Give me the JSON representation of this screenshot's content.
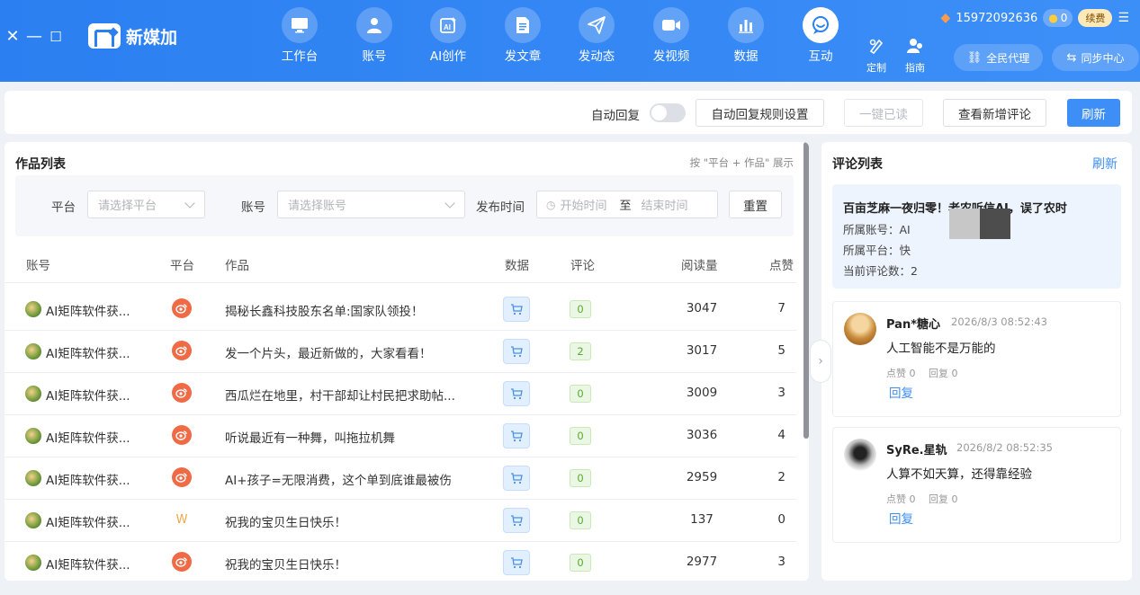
{
  "window": {
    "close": "✕",
    "minimize": "—",
    "maximize": "☐"
  },
  "brand": {
    "name": "新媒加"
  },
  "nav": [
    {
      "label": "工作台",
      "icon": "monitor-icon"
    },
    {
      "label": "账号",
      "icon": "user-icon"
    },
    {
      "label": "AI创作",
      "icon": "ai-icon"
    },
    {
      "label": "发文章",
      "icon": "document-icon"
    },
    {
      "label": "发动态",
      "icon": "paper-plane-icon"
    },
    {
      "label": "发视频",
      "icon": "video-camera-icon"
    },
    {
      "label": "数据",
      "icon": "bar-chart-icon"
    },
    {
      "label": "互动",
      "icon": "chat-bubble-icon",
      "active": true
    }
  ],
  "small_nav": [
    {
      "label": "定制",
      "icon": "customize-icon"
    },
    {
      "label": "指南",
      "icon": "guide-icon"
    }
  ],
  "pills": {
    "agent": "全民代理",
    "sync": "同步中心"
  },
  "account": {
    "phone": "15972092636",
    "coins": "0",
    "renew": "续费",
    "menu": "☰"
  },
  "toolbar": {
    "auto_reply_label": "自动回复",
    "auto_reply_rules": "自动回复规则设置",
    "mark_all_read": "一键已读",
    "view_new_comments": "查看新增评论",
    "refresh": "刷新"
  },
  "works": {
    "title": "作品列表",
    "hint": "按 \"平台 + 作品\" 展示",
    "filters": {
      "platform_label": "平台",
      "platform_placeholder": "请选择平台",
      "account_label": "账号",
      "account_placeholder": "请选择账号",
      "time_label": "发布时间",
      "start_placeholder": "开始时间",
      "to": "至",
      "end_placeholder": "结束时间",
      "reset": "重置"
    },
    "columns": [
      "账号",
      "平台",
      "作品",
      "数据",
      "评论",
      "阅读量",
      "点赞"
    ],
    "rows": [
      {
        "account": "AI矩阵软件获...",
        "platform": "weibo",
        "title": "揭秘长鑫科技股东名单:国家队领投！",
        "comments": "0",
        "reads": "3047",
        "likes": "7"
      },
      {
        "account": "AI矩阵软件获...",
        "platform": "weibo",
        "title": "发一个片头，最近新做的，大家看看！",
        "comments": "2",
        "reads": "3017",
        "likes": "5"
      },
      {
        "account": "AI矩阵软件获...",
        "platform": "weibo",
        "title": "西瓜烂在地里，村干部却让村民把求助帖...",
        "comments": "0",
        "reads": "3009",
        "likes": "3"
      },
      {
        "account": "AI矩阵软件获...",
        "platform": "weibo",
        "title": "听说最近有一种舞，叫拖拉机舞",
        "comments": "0",
        "reads": "3036",
        "likes": "4"
      },
      {
        "account": "AI矩阵软件获...",
        "platform": "weibo",
        "title": "AI+孩子=无限消费，这个单到底谁最被伤",
        "comments": "0",
        "reads": "2959",
        "likes": "2"
      },
      {
        "account": "AI矩阵软件获...",
        "platform": "w",
        "title": "祝我的宝贝生日快乐！",
        "comments": "0",
        "reads": "137",
        "likes": "0"
      },
      {
        "account": "AI矩阵软件获...",
        "platform": "weibo",
        "title": "祝我的宝贝生日快乐！",
        "comments": "0",
        "reads": "2977",
        "likes": "3"
      }
    ]
  },
  "comments": {
    "title": "评论列表",
    "refresh": "刷新",
    "post": {
      "title": "百亩芝麻一夜归零！老农听信AI，误了农时",
      "account": "所属账号：AI",
      "platform": "所属平台：快",
      "count": "当前评论数：2"
    },
    "items": [
      {
        "name": "Pan*糖心",
        "time": "2026/8/3 08:52:43",
        "text": "人工智能不是万能的",
        "likes": "点赞 0",
        "replies": "回复 0",
        "reply": "回复"
      },
      {
        "name": "SyRe.星轨",
        "time": "2026/8/2 08:52:35",
        "text": "人算不如天算，还得靠经验",
        "likes": "点赞 0",
        "replies": "回复 0",
        "reply": "回复"
      }
    ]
  }
}
